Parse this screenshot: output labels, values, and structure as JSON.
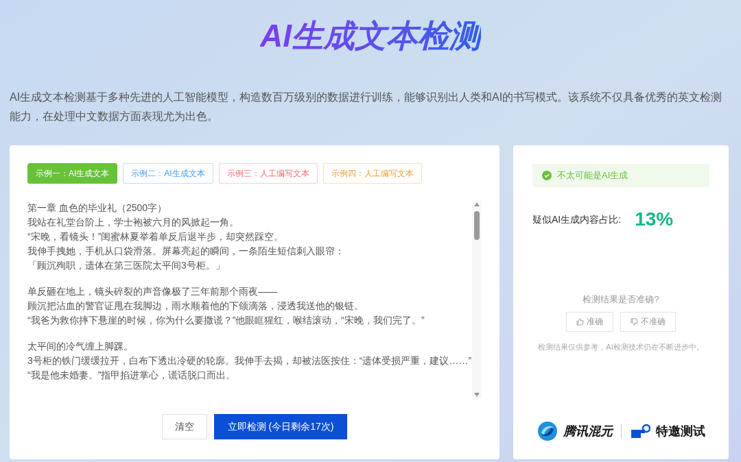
{
  "title": "AI生成文本检测",
  "description": "AI生成文本检测基于多种先进的人工智能模型，构造数百万级别的数据进行训练，能够识别出人类和AI的书写模式。该系统不仅具备优秀的英文检测能力，在处理中文数据方面表现尤为出色。",
  "examples": [
    {
      "label": "示例一：AI生成文本",
      "selected": true,
      "color": "#67c23a"
    },
    {
      "label": "示例二：AI生成文本",
      "selected": false,
      "color": "#409eff"
    },
    {
      "label": "示例三：人工编写文本",
      "selected": false,
      "color": "#f56c6c"
    },
    {
      "label": "示例四：人工编写文本",
      "selected": false,
      "color": "#e6a23c"
    }
  ],
  "paragraphs": [
    [
      "第一章 血色的毕业礼（2500字）",
      "我站在礼堂台阶上，学士袍被六月的风掀起一角。",
      "“宋晚，看镜头！”闺蜜林夏举着单反后退半步，却突然踩空。",
      "我伸手拽她，手机从口袋滑落。屏幕亮起的瞬间，一条陌生短信刺入眼帘：",
      "「顾沉殉职，遗体在第三医院太平间3号柜。」"
    ],
    [
      "单反砸在地上，镜头碎裂的声音像极了三年前那个雨夜——",
      "顾沉把沾血的警官证甩在我脚边，雨水顺着他的下颌滴落，浸透我送他的银链。",
      "“我爸为救你摔下悬崖的时候，你为什么要撒谎？”他眼眶猩红，喉结滚动，“宋晚，我们完了。”"
    ],
    [
      "太平间的冷气缠上脚踝。",
      "3号柜的铁门缓缓拉开，白布下透出冷硬的轮廓。我伸手去揭，却被法医按住：“遗体受损严重，建议……”",
      "“我是他未婚妻。”指甲掐进掌心，谎话脱口而出。"
    ]
  ],
  "buttons": {
    "clear": "清空",
    "detect": "立即检测 (今日剩余17次)"
  },
  "result": {
    "verdict": "不太可能是AI生成",
    "ratio_label": "疑似AI生成内容占比:",
    "ratio": "13%",
    "feedback_question": "检测结果是否准确?",
    "accurate": "准确",
    "inaccurate": "不准确",
    "disclaimer": "检测结果仅供参考，AI检测技术仍在不断进步中。"
  },
  "footer": {
    "brand": "腾讯混元",
    "badge": "特邀测试"
  }
}
